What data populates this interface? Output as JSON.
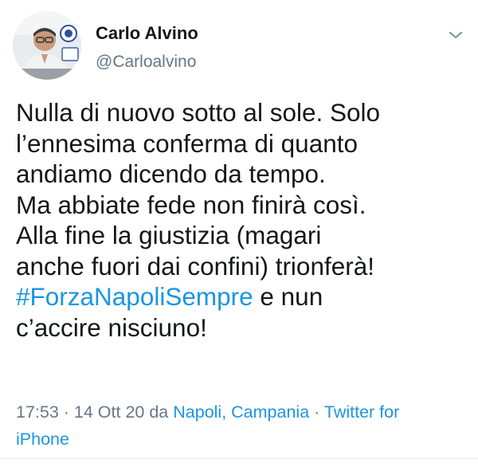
{
  "user": {
    "name": "Carlo Alvino",
    "handle": "@Carloalvino"
  },
  "tweet": {
    "lines": [
      "Nulla di nuovo sotto al sole. Solo",
      "l’ennesima conferma di quanto",
      "andiamo dicendo da tempo.",
      "Ma abbiate fede non finirà così.",
      "Alla fine la giustizia (magari",
      "anche fuori dai confini) trionferà!"
    ],
    "hashtag": "#ForzaNapoliSempre",
    "after_hashtag": " e nun",
    "last_line": "c’accire nisciuno!"
  },
  "meta": {
    "time": "17:53",
    "sep1": " · ",
    "date": "14 Ott 20",
    "da": " da ",
    "location": "Napoli, Campania",
    "sep2": " · ",
    "source_part1": "Twitter for",
    "source_part2": "iPhone"
  },
  "colors": {
    "link": "#1b95e0",
    "secondary": "#657786",
    "text": "#14171a"
  },
  "icons": {
    "menu": "chevron-down-icon"
  }
}
